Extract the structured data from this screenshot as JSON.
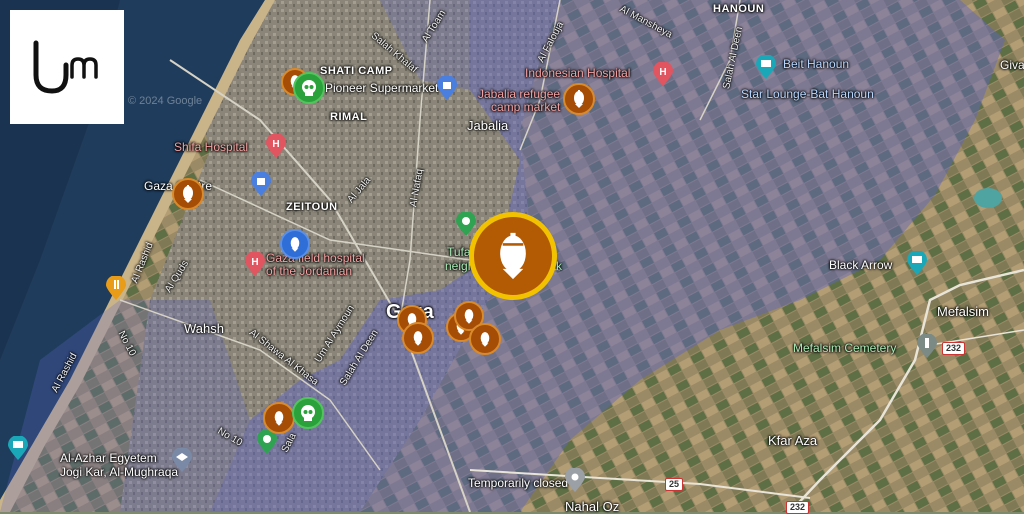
{
  "logo": {
    "icon": "um-logo-icon"
  },
  "watermark": "© 2024 Google",
  "colors": {
    "overlay": "#6b6fd0",
    "marker_bomb": "#a54d07",
    "marker_highlight_ring": "#f2c200",
    "marker_skull": "#2aa13a",
    "poi_hospital": "#e05560"
  },
  "labels": {
    "indonesian_hospital": "Indonesian Hospital",
    "beit_hanoun": "Beit Hanoun",
    "star_lounge": "Star Lounge-Bat Hanoun",
    "hanoun": "HANOUN",
    "jabalia_refugee": "Jabalia refugee",
    "camp_market": "camp market",
    "jabalia": "Jabalia",
    "al_falouja": "Al Falouja",
    "al_mansheya": "Al Mansheya",
    "al_toam": "Al Toam",
    "salah_khalaf": "Salah Khalaf",
    "salah_al_deen_north": "Salah Al Deen",
    "shati_camp": "SHATI CAMP",
    "supermarket": "Pioneer Supermarket",
    "rimal": "RIMAL",
    "shifa_hospital": "Shifa Hospital",
    "gaza_centre": "Gaza  Centre",
    "zeitoun": "ZEITOUN",
    "al_jala": "Al Jala",
    "al_nafaq": "Al Nafaq",
    "field_hospital_1": "Gaza field hospital",
    "field_hospital_2": "of the Jordanian",
    "tufah_1": "Tufah",
    "tufah_2": "neighbo",
    "tufah_3": "k",
    "al_rashid": "Al Rashid",
    "al_quds": "Al Quds",
    "wahsh": "Wahsh",
    "gaza": "Gaza",
    "no10": "No 10",
    "al_shawa": "Al Shawa Al Khasa",
    "umm_al_aymoun": "Um Al Aymoun",
    "salah_al_deen": "Salah Al Deen",
    "al_rashid_south": "Al Rashid",
    "no10_south": "No 10",
    "salah_south": "Sala",
    "al_azhar": "Al-Azhar Egyetem",
    "jogi_kar": "Jogi Kar, Al-Mughraqa",
    "temporarily_closed": "Temporarily closed",
    "nahal_oz": "Nahal Oz",
    "black_arrow": "Black Arrow",
    "mefalsim": "Mefalsim",
    "mefalsim_cemetery": "Mefalsim Cemetery",
    "kfar_aza": "Kfar Aza",
    "giva": "Giva",
    "salah_al_deen_ne": "Salah Al Deen",
    "road_232_a": "232",
    "road_232_b": "232",
    "road_25": "25"
  }
}
